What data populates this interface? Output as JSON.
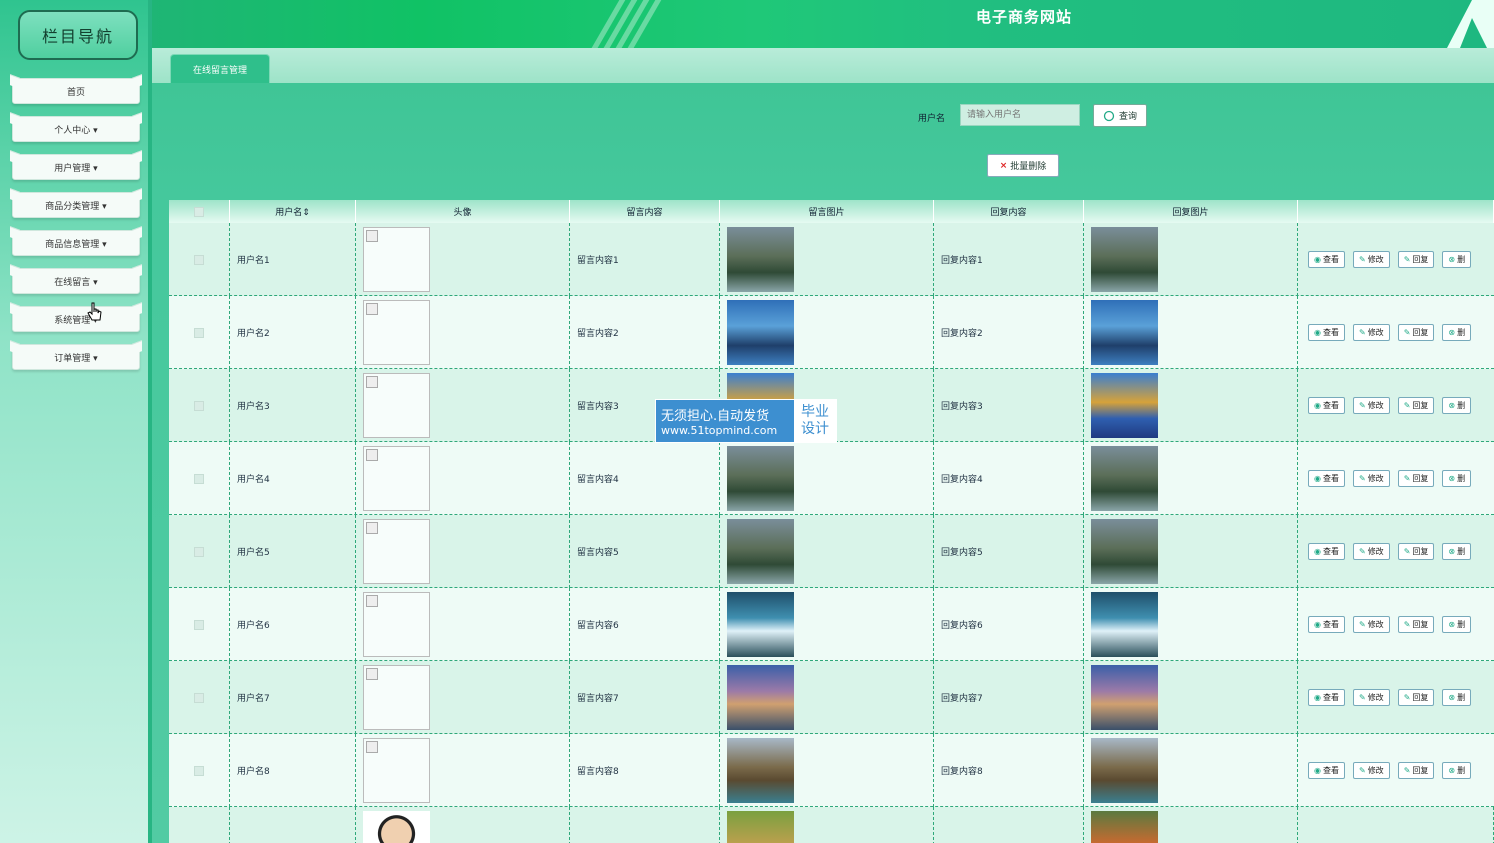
{
  "sidebar": {
    "title": "栏目导航",
    "items": [
      {
        "label": "首页"
      },
      {
        "label": "个人中心 ▾"
      },
      {
        "label": "用户管理 ▾"
      },
      {
        "label": "商品分类管理 ▾"
      },
      {
        "label": "商品信息管理 ▾"
      },
      {
        "label": "在线留言 ▾"
      },
      {
        "label": "系统管理 ▾"
      },
      {
        "label": "订单管理 ▾"
      }
    ]
  },
  "header": {
    "site_title": "电子商务网站"
  },
  "tabs": [
    {
      "label": "在线留言管理"
    }
  ],
  "search": {
    "label": "用户名",
    "placeholder": "请输入用户名",
    "button_label": "查询"
  },
  "toolbar": {
    "batch_delete_label": "批量删除"
  },
  "table": {
    "columns": [
      "",
      "用户名⇕",
      "头像",
      "留言内容",
      "留言图片",
      "回复内容",
      "回复图片",
      ""
    ],
    "actions": {
      "view": "查看",
      "edit": "修改",
      "reply": "回复",
      "delete": "删"
    },
    "rows": [
      {
        "username": "用户名1",
        "content": "留言内容1",
        "reply": "回复内容1"
      },
      {
        "username": "用户名2",
        "content": "留言内容2",
        "reply": "回复内容2"
      },
      {
        "username": "用户名3",
        "content": "留言内容3",
        "reply": "回复内容3"
      },
      {
        "username": "用户名4",
        "content": "留言内容4",
        "reply": "回复内容4"
      },
      {
        "username": "用户名5",
        "content": "留言内容5",
        "reply": "回复内容5"
      },
      {
        "username": "用户名6",
        "content": "留言内容6",
        "reply": "回复内容6"
      },
      {
        "username": "用户名7",
        "content": "留言内容7",
        "reply": "回复内容7"
      },
      {
        "username": "用户名8",
        "content": "留言内容8",
        "reply": "回复内容8"
      }
    ]
  },
  "watermark": {
    "line1": "无须担心.自动发货",
    "line2": "www.51topmind.com",
    "side1": "毕业",
    "side2": "设计"
  },
  "colors": {
    "accent": "#2fbf8b",
    "header": "#1fc878",
    "border": "#2fa87a"
  }
}
